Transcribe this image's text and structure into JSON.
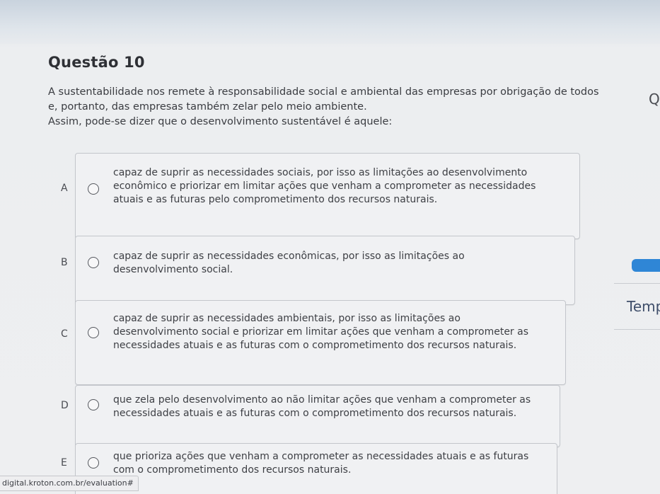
{
  "question": {
    "title": "Questão 10",
    "statement_lines": [
      "A sustentabilidade nos remete à responsabilidade social e ambiental das empresas por obrigação de todos",
      "e, portanto, das empresas também zelar pelo meio ambiente.",
      "Assim, pode-se dizer que o desenvolvimento sustentável é aquele:"
    ]
  },
  "options": [
    {
      "letter": "A",
      "lines": [
        "capaz de suprir as necessidades sociais, por isso as limitações ao desenvolvimento",
        "econômico e priorizar em limitar ações que venham a comprometer as necessidades",
        "atuais e as futuras pelo comprometimento dos recursos naturais."
      ]
    },
    {
      "letter": "B",
      "lines": [
        "capaz de suprir as necessidades econômicas, por isso as limitações ao",
        "desenvolvimento social."
      ]
    },
    {
      "letter": "C",
      "lines": [
        "capaz de suprir as necessidades ambientais, por isso as limitações ao",
        "desenvolvimento social e priorizar em limitar ações que venham a comprometer as",
        "necessidades atuais e as futuras com o comprometimento dos recursos naturais."
      ]
    },
    {
      "letter": "D",
      "lines": [
        "que zela pelo desenvolvimento ao não limitar ações que venham a comprometer as",
        "necessidades atuais e as futuras com o comprometimento dos recursos naturais."
      ]
    },
    {
      "letter": "E",
      "lines": [
        "que prioriza ações que venham a comprometer as necessidades atuais e as futuras",
        "com o comprometimento dos recursos naturais."
      ]
    }
  ],
  "sidebar": {
    "question_label_fragment": "Q",
    "timer_label_fragment": "Temp"
  },
  "status_bar": {
    "url": "digital.kroton.com.br/evaluation#"
  },
  "colors": {
    "accent": "#2f86d6",
    "text": "#3d3f44",
    "option_bg": "#f0f1f3"
  }
}
